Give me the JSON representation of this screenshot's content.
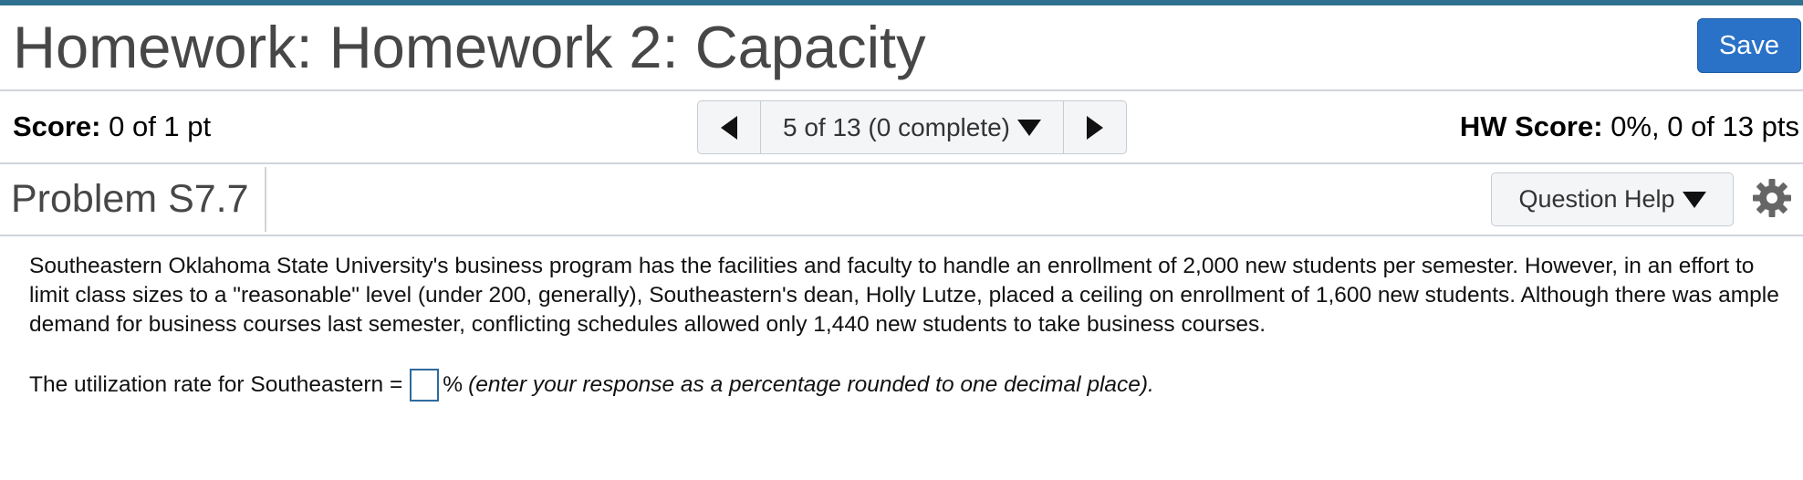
{
  "header": {
    "title": "Homework: Homework 2: Capacity",
    "save_label": "Save"
  },
  "score_bar": {
    "score_label": "Score:",
    "score_value": "0 of 1 pt",
    "navigation": {
      "position_label": "5 of 13 (0 complete)"
    },
    "hw_score_label": "HW Score:",
    "hw_score_value": "0%, 0 of 13 pts"
  },
  "problem": {
    "title": "Problem S7.7",
    "help_label": "Question Help",
    "text": "Southeastern Oklahoma State University's business program has the facilities and faculty to handle an enrollment of 2,000 new students per semester. However, in an effort to limit class sizes to a \"reasonable\" level (under 200, generally), Southeastern's dean, Holly Lutze, placed a ceiling on enrollment of 1,600 new students. Although there was ample demand for business courses last semester, conflicting schedules allowed only 1,440 new students to take business courses.",
    "question_prefix": "The utilization rate for Southeastern =",
    "answer_value": "",
    "question_unit": "%",
    "question_hint": "(enter your response as a percentage rounded to one decimal place)."
  },
  "colors": {
    "accent_bar": "#2e7191",
    "save_button": "#2a72c7",
    "input_border": "#2e6b9e"
  },
  "icons": {
    "prev": "triangle-left",
    "next": "triangle-right",
    "dropdown": "triangle-down",
    "settings": "gear"
  }
}
